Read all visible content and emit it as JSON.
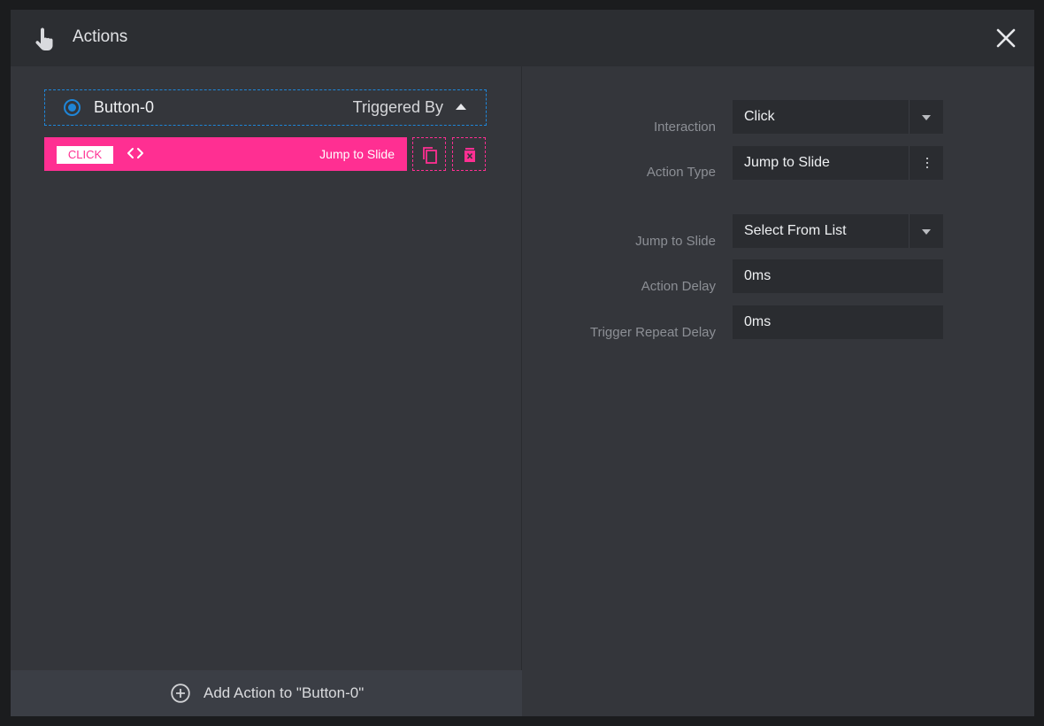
{
  "header": {
    "title": "Actions",
    "hand_icon": "hand-pointer-icon",
    "close_icon": "close-icon"
  },
  "trigger": {
    "name": "Button-0",
    "triggered_by_label": "Triggered By"
  },
  "action_item": {
    "event_badge": "CLICK",
    "action_label": "Jump to Slide",
    "code_icon": "code-brackets-icon",
    "copy_icon": "copy-icon",
    "delete_icon": "trash-icon"
  },
  "add_action": {
    "label": "Add Action to \"Button-0\"",
    "icon": "plus-circle-icon"
  },
  "settings": {
    "interaction": {
      "label": "Interaction",
      "value": "Click"
    },
    "action_type": {
      "label": "Action Type",
      "value": "Jump to Slide"
    },
    "jump_to_slide": {
      "label": "Jump to Slide",
      "value": "Select From List"
    },
    "action_delay": {
      "label": "Action Delay",
      "value": "0ms"
    },
    "trigger_repeat_delay": {
      "label": "Trigger Repeat Delay",
      "value": "0ms"
    }
  },
  "colors": {
    "accent_pink": "#ff2f92",
    "accent_blue": "#1f86d8",
    "panel_bg": "#34363b",
    "header_bg": "#2c2e32",
    "field_bg": "#2a2c30"
  }
}
